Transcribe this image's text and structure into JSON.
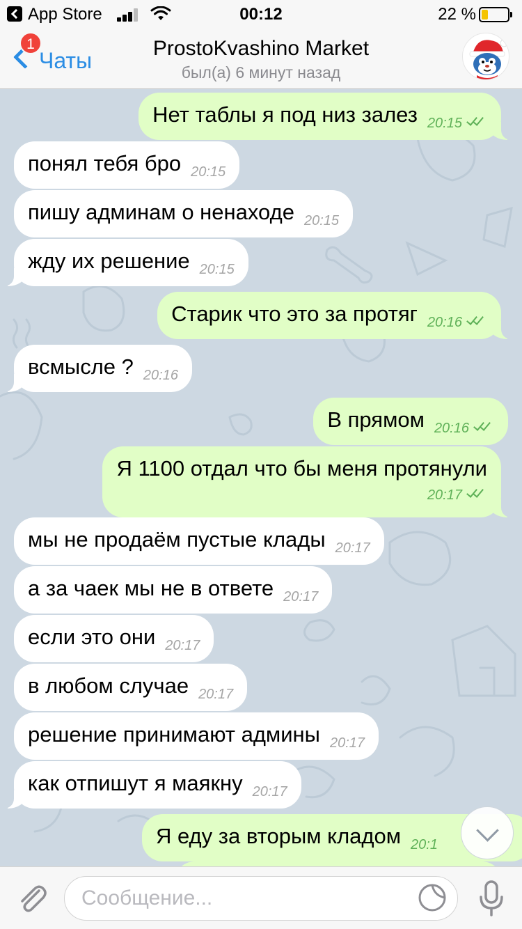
{
  "status_bar": {
    "back_app": "App Store",
    "time": "00:12",
    "battery": "22 %"
  },
  "header": {
    "back_label": "Чаты",
    "unread_badge": "1",
    "title": "ProstoKvashino Market",
    "subtitle": "был(а) 6 минут назад",
    "accent_color": "#2b8de4"
  },
  "messages": [
    {
      "dir": "out",
      "text": "Нет таблы я под низ залез",
      "time": "20:15",
      "read": true
    },
    {
      "dir": "in",
      "text": "понял тебя бро",
      "time": "20:15"
    },
    {
      "dir": "in",
      "text": "пишу админам о ненаходе",
      "time": "20:15"
    },
    {
      "dir": "in",
      "text": "жду их решение",
      "time": "20:15"
    },
    {
      "dir": "out",
      "text": "Старик что это за протяг",
      "time": "20:16",
      "read": true
    },
    {
      "dir": "in",
      "text": "всмысле ?",
      "time": "20:16"
    },
    {
      "dir": "out",
      "text": "В прямом",
      "time": "20:16",
      "read": true
    },
    {
      "dir": "out",
      "text": "Я 1100 отдал что бы меня протянули",
      "time": "20:17",
      "read": true
    },
    {
      "dir": "in",
      "text": "мы не продаём пустые клады",
      "time": "20:17"
    },
    {
      "dir": "in",
      "text": "а за чаек мы не в ответе",
      "time": "20:17"
    },
    {
      "dir": "in",
      "text": "если это они",
      "time": "20:17"
    },
    {
      "dir": "in",
      "text": "в любом случае",
      "time": "20:17"
    },
    {
      "dir": "in",
      "text": "решение принимают админы",
      "time": "20:17"
    },
    {
      "dir": "in",
      "text": "как отпишут я маякну",
      "time": "20:17"
    },
    {
      "dir": "out",
      "text": "Я еду за вторым кладом",
      "time": "20:1"
    }
  ],
  "input": {
    "placeholder": "Сообщение..."
  },
  "colors": {
    "incoming_bubble": "#ffffff",
    "outgoing_bubble": "#e1fec6",
    "read_check": "#5fb158",
    "badge": "#f0423a",
    "chat_background": "#cdd8e2"
  },
  "icons": [
    "back-arrow-icon",
    "signal-icon",
    "wifi-icon",
    "battery-icon",
    "chevron-left-icon",
    "avatar",
    "double-check-icon",
    "scroll-down-icon",
    "paperclip-icon",
    "sticker-icon",
    "microphone-icon"
  ]
}
